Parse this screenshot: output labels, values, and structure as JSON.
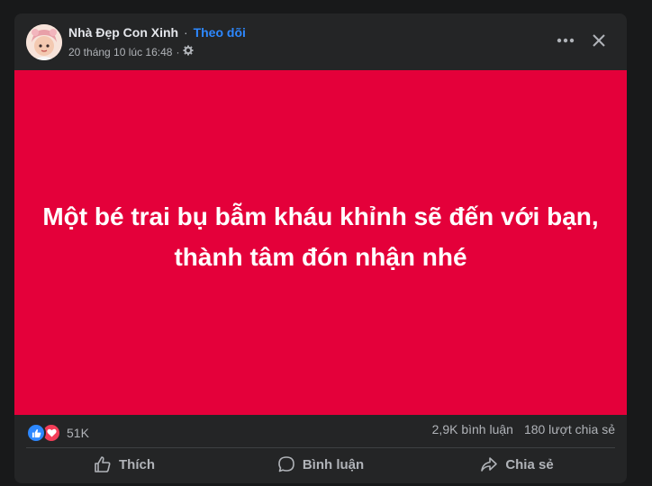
{
  "post": {
    "page_name": "Nhà Đẹp Con Xinh",
    "separator": "·",
    "follow_label": "Theo dõi",
    "timestamp": "20 tháng 10 lúc 16:48",
    "meta_separator": "·",
    "privacy_icon": "globe-gear-icon",
    "text": "Một bé trai bụ bẫm kháu khỉnh sẽ đến với bạn, thành tâm đón nhận nhé",
    "background_color": "#e4003a"
  },
  "header": {
    "more_icon": "more-options-icon",
    "close_icon": "close-icon"
  },
  "stats": {
    "reactions": [
      "like",
      "love"
    ],
    "reaction_count": "51K",
    "comments": "2,9K bình luận",
    "shares": "180 lượt chia sẻ"
  },
  "actions": {
    "like_label": "Thích",
    "comment_label": "Bình luận",
    "share_label": "Chia sẻ"
  },
  "colors": {
    "accent": "#2d88ff",
    "love": "#f33e58",
    "card_bg": "#242526"
  }
}
